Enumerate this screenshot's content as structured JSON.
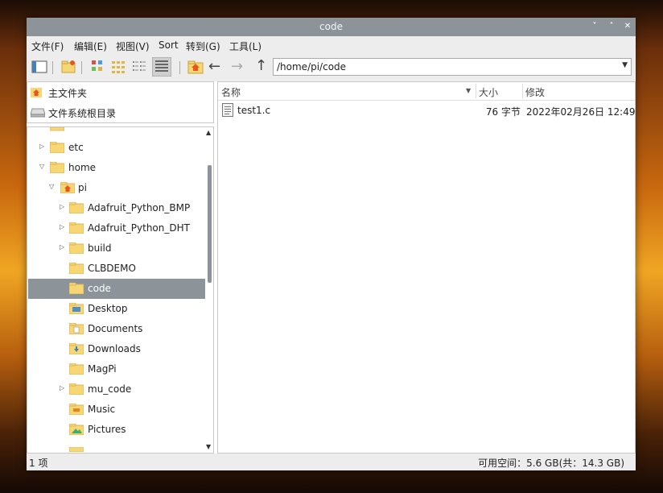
{
  "window": {
    "title": "code",
    "controls": {
      "minimize": "˅",
      "maximize": "˄",
      "close": "✕"
    }
  },
  "menubar": {
    "items": [
      {
        "label": "文件(F)"
      },
      {
        "label": "编辑(E)"
      },
      {
        "label": "视图(V)"
      },
      {
        "label": "Sort"
      },
      {
        "label": "转到(G)"
      },
      {
        "label": "工具(L)"
      }
    ]
  },
  "toolbar": {
    "path": "/home/pi/code",
    "back_glyph": "←",
    "forward_glyph": "→",
    "up_glyph": "↑",
    "dropdown_glyph": "▼",
    "icons": [
      "sidebar-toggle-icon",
      "new-folder-icon",
      "thumbnail-view-icon",
      "icon-view-icon",
      "compact-view-icon",
      "detailed-list-view-icon",
      "home-icon"
    ]
  },
  "places": {
    "items": [
      {
        "label": "主文件夹",
        "icon": "home-icon"
      },
      {
        "label": "文件系统根目录",
        "icon": "drive-icon"
      }
    ]
  },
  "tree": {
    "items": [
      {
        "label": "etc",
        "arrow": "▷"
      },
      {
        "label": "home",
        "arrow": "▽"
      },
      {
        "label": "pi",
        "arrow": "▽"
      },
      {
        "label": "Adafruit_Python_BMP",
        "arrow": "▷"
      },
      {
        "label": "Adafruit_Python_DHT",
        "arrow": "▷"
      },
      {
        "label": "build",
        "arrow": "▷"
      },
      {
        "label": "CLBDEMO",
        "arrow": ""
      },
      {
        "label": "code",
        "arrow": ""
      },
      {
        "label": "Desktop",
        "arrow": ""
      },
      {
        "label": "Documents",
        "arrow": ""
      },
      {
        "label": "Downloads",
        "arrow": ""
      },
      {
        "label": "MagPi",
        "arrow": ""
      },
      {
        "label": "mu_code",
        "arrow": "▷"
      },
      {
        "label": "Music",
        "arrow": ""
      },
      {
        "label": "Pictures",
        "arrow": ""
      }
    ],
    "selected": "code"
  },
  "file_list": {
    "columns": {
      "name": "名称",
      "size": "大小",
      "modified": "修改",
      "sort_glyph": "▼"
    },
    "rows": [
      {
        "name": "test1.c",
        "size": "76 字节",
        "modified": "2022年02月26日 12:49"
      }
    ]
  },
  "statusbar": {
    "left": "1 项",
    "right": "可用空间：5.6 GB(共：14.3 GB)"
  },
  "colors": {
    "titlebar": "#8c949a",
    "selection": "#8c949a",
    "folder": "#f7d774",
    "home_badge": "#e8541f"
  }
}
